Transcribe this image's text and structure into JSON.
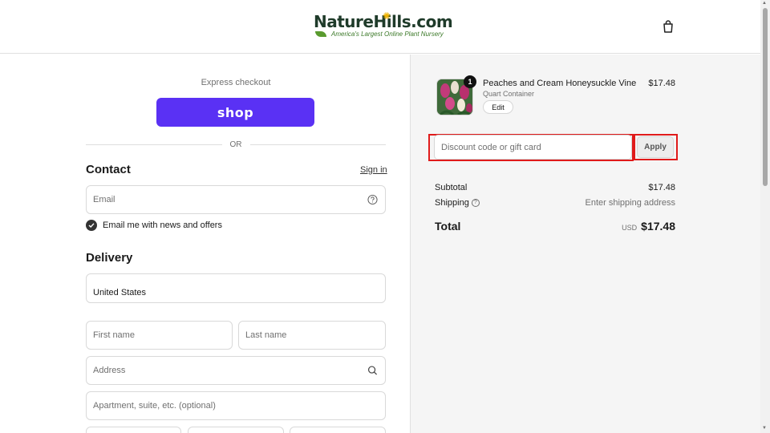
{
  "brand": {
    "name": "NatureHills.com",
    "tagline": "America's Largest Online Plant Nursery"
  },
  "checkout": {
    "express_label": "Express checkout",
    "shop_button": "shop",
    "or_divider": "OR"
  },
  "contact": {
    "title": "Contact",
    "sign_in": "Sign in",
    "email_placeholder": "Email",
    "newsletter_label": "Email me with news and offers",
    "newsletter_checked": true
  },
  "delivery": {
    "title": "Delivery",
    "country": "United States",
    "first_name_placeholder": "First name",
    "last_name_placeholder": "Last name",
    "address_placeholder": "Address",
    "apartment_placeholder": "Apartment, suite, etc. (optional)"
  },
  "order": {
    "items": [
      {
        "name": "Peaches and Cream Honeysuckle Vine",
        "variant": "Quart Container",
        "quantity": "1",
        "price": "$17.48",
        "edit_label": "Edit"
      }
    ],
    "discount_placeholder": "Discount code or gift card",
    "apply_label": "Apply",
    "subtotal_label": "Subtotal",
    "subtotal_value": "$17.48",
    "shipping_label": "Shipping",
    "shipping_value": "Enter shipping address",
    "total_label": "Total",
    "currency": "USD",
    "total_value": "$17.48"
  },
  "colors": {
    "shop_purple": "#5a31f4",
    "highlight_red": "#e01b1b"
  }
}
